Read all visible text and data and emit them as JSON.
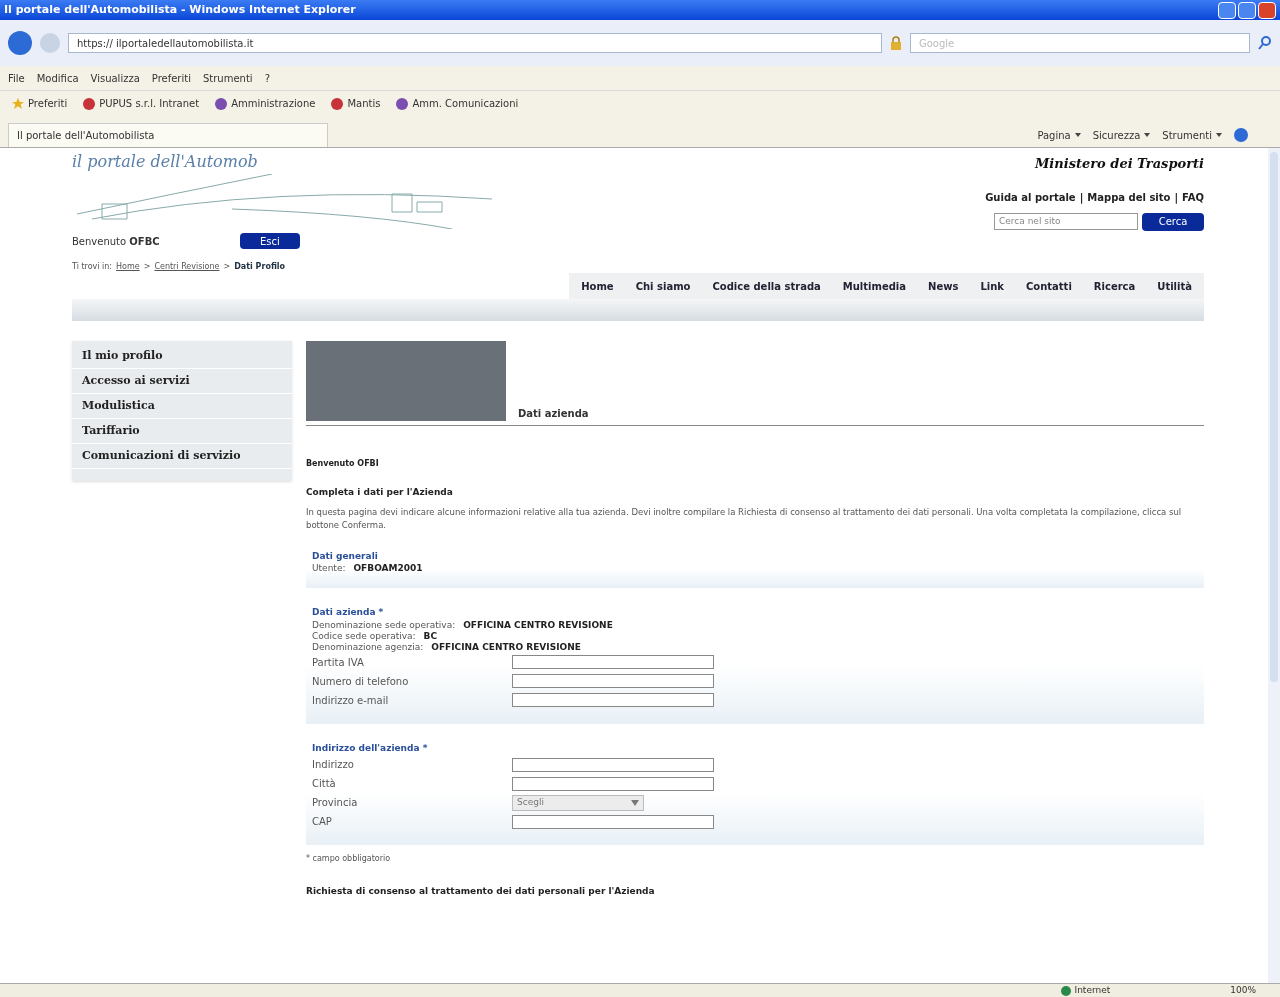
{
  "window": {
    "title": "Il portale dell'Automobilista - Windows Internet Explorer"
  },
  "address_bar": {
    "url": "https:// ilportaledellautomobilista.it",
    "search_placeholder": "Google"
  },
  "menu": [
    "File",
    "Modifica",
    "Visualizza",
    "Preferiti",
    "Strumenti",
    "?"
  ],
  "favorites": [
    {
      "label": "Preferiti",
      "kind": "star"
    },
    {
      "label": "PUPUS s.r.l. Intranet",
      "kind": "red"
    },
    {
      "label": "Amministrazione",
      "kind": "purple"
    },
    {
      "label": "Mantis",
      "kind": "red"
    },
    {
      "label": "Amm. Comunicazioni",
      "kind": "purple"
    }
  ],
  "tab": {
    "title": "Il portale dell'Automobilista"
  },
  "command_bar": [
    "Pagina",
    "Sicurezza",
    "Strumenti"
  ],
  "site": {
    "logo": "il portale dell'Automob",
    "ministry": "Ministero dei Trasporti",
    "top_links": [
      "Guida al portale",
      "|",
      "Mappa del sito",
      "|",
      "FAQ"
    ],
    "search": {
      "placeholder": "Cerca nel sito",
      "button": "Cerca"
    },
    "welcome": {
      "label": "Benvenuto",
      "user": "OFBC",
      "button": "Esci"
    },
    "breadcrumb": {
      "prefix": "Ti trovi in:",
      "links": [
        "Home",
        "Centri Revisione"
      ],
      "separator": ">",
      "current": "Dati Profilo"
    },
    "nav": [
      "Home",
      "Chi siamo",
      "Codice della strada",
      "Multimedia",
      "News",
      "Link",
      "Contatti",
      "Ricerca",
      "Utilità"
    ],
    "sidebar": [
      "Il mio profilo",
      "Accesso ai servizi",
      "Modulistica",
      "Tariffario",
      "Comunicazioni di servizio"
    ],
    "page_title": "Dati azienda",
    "greeting": "Benvenuto OFBI",
    "subtitle": "Completa i dati per l'Azienda",
    "intro": "In questa pagina devi indicare alcune informazioni relative alla tua azienda. Devi inoltre compilare la Richiesta di consenso al trattamento dei dati personali. Una volta completata la compilazione, clicca sul bottone Conferma.",
    "sections": [
      {
        "title": "Dati generali",
        "info": [
          {
            "label": "Utente:",
            "value": "OFBOAM2001"
          }
        ]
      },
      {
        "title": "Dati azienda *",
        "info": [
          {
            "label": "Denominazione sede operativa:",
            "value": "OFFICINA CENTRO REVISIONE"
          },
          {
            "label": "Codice sede operativa:",
            "value": "BC"
          },
          {
            "label": "Denominazione agenzia:",
            "value": "OFFICINA CENTRO REVISIONE"
          }
        ],
        "fields": [
          {
            "label": "Partita IVA",
            "kind": "text"
          },
          {
            "label": "Numero di telefono",
            "kind": "text"
          },
          {
            "label": "Indirizzo e-mail",
            "kind": "text"
          }
        ]
      },
      {
        "title": "Indirizzo dell'azienda *",
        "fields": [
          {
            "label": "Indirizzo",
            "kind": "text"
          },
          {
            "label": "Città",
            "kind": "text"
          },
          {
            "label": "Provincia",
            "kind": "select",
            "value": "Scegli",
            "disabled": true
          },
          {
            "label": "CAP",
            "kind": "text"
          }
        ]
      }
    ],
    "required_note": "* campo obbligatorio",
    "consent_title": "Richiesta di consenso al trattamento dei dati personali per l'Azienda"
  },
  "status_bar": {
    "zone": "Internet",
    "zoom": "100%"
  }
}
